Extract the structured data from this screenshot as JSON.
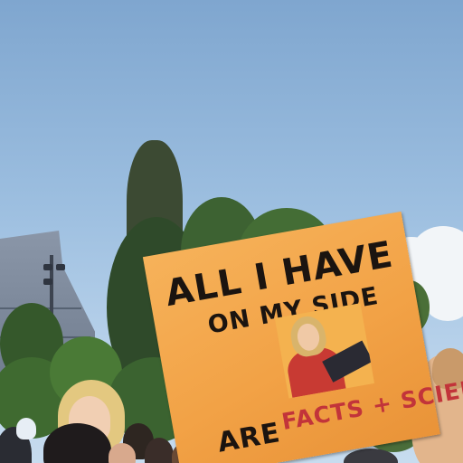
{
  "sign": {
    "line1": "ALL I HAVE",
    "line2": "ON MY SIDE",
    "line3": "ARE",
    "line4": "FACTS + SCIENCE"
  },
  "colors": {
    "sky": "#9dbfe0",
    "sign": "#f2a246",
    "marker_black": "#1b1410",
    "marker_red": "#c2343a"
  }
}
